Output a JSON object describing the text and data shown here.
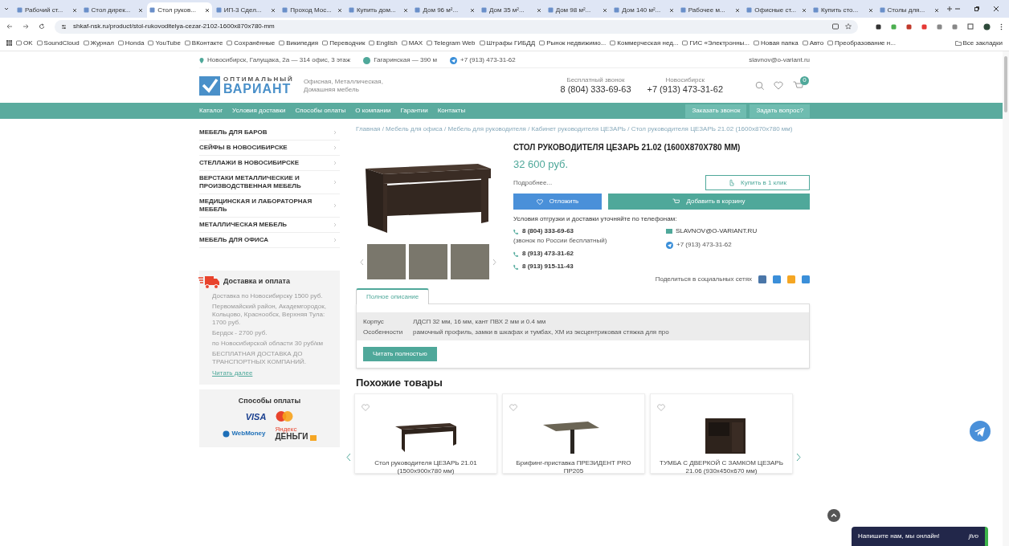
{
  "browser": {
    "tabs": [
      {
        "title": "Рабочий ст...",
        "selected": false
      },
      {
        "title": "Стол дирек...",
        "selected": false
      },
      {
        "title": "Стол руков...",
        "selected": true
      },
      {
        "title": "ИП-3 Сдел...",
        "selected": false
      },
      {
        "title": "Проход Мос...",
        "selected": false
      },
      {
        "title": "Купить дом...",
        "selected": false
      },
      {
        "title": "Дом 96 м²...",
        "selected": false
      },
      {
        "title": "Дом 35 м²...",
        "selected": false
      },
      {
        "title": "Дом 98 м²...",
        "selected": false
      },
      {
        "title": "Дом 140 м²...",
        "selected": false
      },
      {
        "title": "Рабочее м...",
        "selected": false
      },
      {
        "title": "Офисные ст...",
        "selected": false
      },
      {
        "title": "Купить сто...",
        "selected": false
      },
      {
        "title": "Столы для...",
        "selected": false
      }
    ],
    "url": "shkaf-nsk.ru/product/stol-rukovoditelya-cezar-2102-1600x870x780-mm",
    "bookmarks": [
      "OK",
      "SoundCloud",
      "Журнал",
      "Honda",
      "YouTube",
      "ВКонтакте",
      "Сохранённые",
      "Википедия",
      "Переводчик",
      "English",
      "MAX",
      "Telegram Web",
      "Штрафы ГИБДД",
      "Рынок недвижимо...",
      "Коммерческая нед...",
      "ГИС «Электронны...",
      "Новая папка",
      "Авто",
      "Преобразование н..."
    ],
    "all_bookmarks": "Все закладки"
  },
  "site": {
    "topbar": {
      "address": "Новосибирск, Галущака, 2а — 314 офис, 3 этаж",
      "metro": "Гагаринская — 390 м",
      "telegram": "+7 (913) 473-31-62",
      "email": "slavnov@o-variant.ru"
    },
    "logo": {
      "top": "ОПТИМАЛЬНЫЙ",
      "bottom": "ВАРИАНТ",
      "tagline": "Офисная, Металлическая, Домашняя мебель"
    },
    "phones": [
      {
        "caption": "Бесплатный звонок",
        "number": "8 (804) 333-69-63"
      },
      {
        "caption": "Новосибирск",
        "number": "+7 (913) 473-31-62"
      }
    ],
    "cart_count": "0",
    "nav": [
      "Каталог",
      "Условия доставки",
      "Способы оплаты",
      "О компании",
      "Гарантии",
      "Контакты"
    ],
    "nav_buttons": [
      "Заказать звонок",
      "Задать вопрос?"
    ],
    "sidebar": [
      "МЕБЕЛЬ ДЛЯ БАРОВ",
      "СЕЙФЫ В НОВОСИБИРСКЕ",
      "СТЕЛЛАЖИ В НОВОСИБИРСКЕ",
      "ВЕРСТАКИ МЕТАЛЛИЧЕСКИЕ И ПРОИЗВОДСТВЕННАЯ МЕБЕЛЬ",
      "МЕДИЦИНСКАЯ И ЛАБОРАТОРНАЯ МЕБЕЛЬ",
      "МЕТАЛЛИЧЕСКАЯ МЕБЕЛЬ",
      "МЕБЕЛЬ ДЛЯ ОФИСА"
    ],
    "delivery": {
      "title": "Доставка и оплата",
      "lines": [
        "Доставка по Новосибирску 1500 руб.",
        "Первомайский район, Академгородок, Кольцово, Краснообск, Верхняя Тула: 1700 руб.",
        "Бердск - 2700 руб.",
        "по Новосибирской области 30 руб/км",
        "БЕСПЛАТНАЯ ДОСТАВКА ДО ТРАНСПОРТНЫХ КОМПАНИЙ."
      ],
      "more": "Читать далее"
    },
    "payment": {
      "title": "Способы оплаты",
      "visa": "VISA",
      "webmoney": "WebMoney",
      "yandex_top": "Яндекс",
      "yandex": "ДЕНЬГИ"
    },
    "breadcrumb": "Главная / Мебель для офиса / Мебель для руководителя / Кабинет руководителя ЦЕЗАРЬ / Стол руководителя ЦЕЗАРЬ 21.02 (1600x870x780 мм)",
    "product": {
      "title": "СТОЛ РУКОВОДИТЕЛЯ ЦЕЗАРЬ 21.02 (1600Х870Х780 ММ)",
      "price": "32 600 руб.",
      "details": "Подробнее...",
      "one_click": "Купить в 1 клик",
      "defer": "Отложить",
      "add_to_cart": "Добавить в корзину",
      "shipping_note": "Условия отгрузки и доставки уточняйте по телефонам:",
      "phones": [
        {
          "number": "8 (804) 333-69-63",
          "note": "(звонок по России бесплатный)"
        },
        {
          "number": "8 (913) 473-31-62"
        },
        {
          "number": "8 (913) 915-11-43"
        }
      ],
      "email": "SLAVNOV@O-VARIANT.RU",
      "telegram": "+7 (913) 473-31-62",
      "share": "Поделиться в социальных сетях"
    },
    "description": {
      "tab": "Полное описание",
      "rows": [
        {
          "label": "Корпус",
          "value": "ЛДСП 32 мм, 16 мм, кант ПВХ 2 мм и 0.4 мм"
        },
        {
          "label": "Особенности",
          "value": "рамочный профиль, замки в шкафах и тумбах, ХМ из эксцентриковая стяжка для про"
        }
      ],
      "more": "Читать полностью"
    },
    "similar": {
      "title": "Похожие товары",
      "items": [
        {
          "name": "Стол руководителя ЦЕЗАРЬ 21.01 (1500х900х780 мм)",
          "kind": "desk"
        },
        {
          "name": "Брифинг-приставка ПРЕЗИДЕНТ PRO ПР205",
          "kind": "table"
        },
        {
          "name": "ТУМБА С ДВЕРКОЙ С ЗАМКОМ ЦЕЗАРЬ 21.06 (930х450х670 мм)",
          "kind": "cabinet"
        }
      ]
    },
    "chat": {
      "text": "Напишите нам, мы онлайн!",
      "brand": "jivo"
    }
  }
}
